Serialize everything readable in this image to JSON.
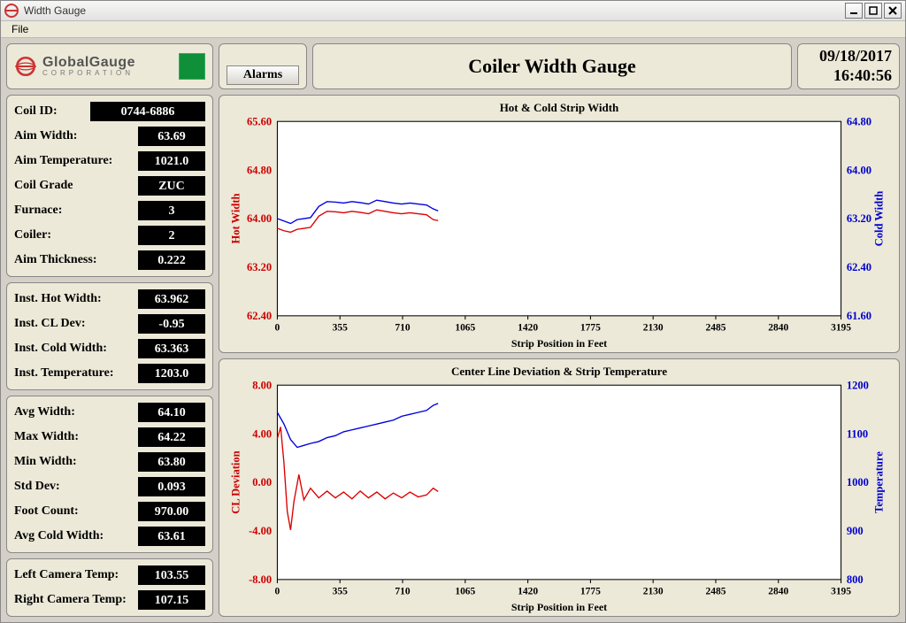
{
  "window": {
    "title": "Width Gauge"
  },
  "menu": {
    "file": "File"
  },
  "brand": {
    "name": "GlobalGauge",
    "sub": "CORPORATION"
  },
  "alarms_label": "Alarms",
  "page_title": "Coiler Width Gauge",
  "datetime": {
    "date": "09/18/2017",
    "time": "16:40:56"
  },
  "group1": {
    "coil_id_label": "Coil ID:",
    "coil_id": "0744-6886",
    "aim_width_label": "Aim Width:",
    "aim_width": "63.69",
    "aim_temp_label": "Aim Temperature:",
    "aim_temp": "1021.0",
    "coil_grade_label": "Coil Grade",
    "coil_grade": "ZUC",
    "furnace_label": "Furnace:",
    "furnace": "3",
    "coiler_label": "Coiler:",
    "coiler": "2",
    "aim_thick_label": "Aim Thickness:",
    "aim_thick": "0.222"
  },
  "group2": {
    "inst_hot_label": "Inst. Hot Width:",
    "inst_hot": "63.962",
    "inst_cl_label": "Inst. CL Dev:",
    "inst_cl": "-0.95",
    "inst_cold_label": "Inst. Cold Width:",
    "inst_cold": "63.363",
    "inst_temp_label": "Inst. Temperature:",
    "inst_temp": "1203.0"
  },
  "group3": {
    "avg_w_label": "Avg Width:",
    "avg_w": "64.10",
    "max_w_label": "Max Width:",
    "max_w": "64.22",
    "min_w_label": "Min Width:",
    "min_w": "63.80",
    "std_label": "Std Dev:",
    "std": "0.093",
    "foot_label": "Foot Count:",
    "foot": "970.00",
    "avg_cold_label": "Avg Cold Width:",
    "avg_cold": "63.61"
  },
  "group4": {
    "left_cam_label": "Left Camera Temp:",
    "left_cam": "103.55",
    "right_cam_label": "Right Camera Temp:",
    "right_cam": "107.15"
  },
  "charts": {
    "x_label": "Strip Position in Feet",
    "x_ticks": [
      "0",
      "355",
      "710",
      "1065",
      "1420",
      "1775",
      "2130",
      "2485",
      "2840",
      "3195"
    ],
    "top": {
      "title": "Hot & Cold Strip Width",
      "left_label": "Hot Width",
      "right_label": "Cold Width",
      "left_ticks": [
        "65.60",
        "64.80",
        "64.00",
        "63.20",
        "62.40"
      ],
      "right_ticks": [
        "64.80",
        "64.00",
        "63.20",
        "62.40",
        "61.60"
      ]
    },
    "bottom": {
      "title": "Center Line Deviation & Strip Temperature",
      "left_label": "CL Deviation",
      "right_label": "Temperature",
      "left_ticks": [
        "8.00",
        "4.00",
        "0.00",
        "-4.00",
        "-8.00"
      ],
      "right_ticks": [
        "1200",
        "1100",
        "1000",
        "900",
        "800"
      ]
    }
  },
  "chart_data": [
    {
      "type": "line",
      "title": "Hot & Cold Strip Width",
      "xlabel": "Strip Position in Feet",
      "xlim": [
        0,
        3400
      ],
      "series": [
        {
          "name": "Hot Width",
          "ylabel": "Hot Width",
          "ylim": [
            62.0,
            66.0
          ],
          "x": [
            0,
            40,
            80,
            120,
            160,
            200,
            250,
            300,
            350,
            400,
            450,
            500,
            550,
            600,
            650,
            700,
            750,
            800,
            850,
            900,
            940,
            970
          ],
          "y": [
            63.8,
            63.75,
            63.72,
            63.78,
            63.8,
            63.82,
            64.05,
            64.15,
            64.14,
            64.12,
            64.15,
            64.13,
            64.1,
            64.18,
            64.15,
            64.12,
            64.1,
            64.12,
            64.1,
            64.08,
            63.98,
            63.96
          ]
        },
        {
          "name": "Cold Width",
          "ylabel": "Cold Width",
          "ylim": [
            61.2,
            65.2
          ],
          "x": [
            0,
            40,
            80,
            120,
            160,
            200,
            250,
            300,
            350,
            400,
            450,
            500,
            550,
            600,
            650,
            700,
            750,
            800,
            850,
            900,
            940,
            970
          ],
          "y": [
            63.2,
            63.15,
            63.1,
            63.18,
            63.2,
            63.22,
            63.45,
            63.55,
            63.54,
            63.52,
            63.55,
            63.53,
            63.5,
            63.58,
            63.55,
            63.52,
            63.5,
            63.52,
            63.5,
            63.48,
            63.4,
            63.36
          ]
        }
      ]
    },
    {
      "type": "line",
      "title": "Center Line Deviation & Strip Temperature",
      "xlabel": "Strip Position in Feet",
      "xlim": [
        0,
        3400
      ],
      "series": [
        {
          "name": "CL Deviation",
          "ylabel": "CL Deviation",
          "ylim": [
            -10,
            10
          ],
          "x": [
            0,
            20,
            40,
            60,
            80,
            100,
            130,
            160,
            200,
            250,
            300,
            350,
            400,
            450,
            500,
            550,
            600,
            650,
            700,
            750,
            800,
            850,
            900,
            940,
            970
          ],
          "y": [
            4.5,
            5.7,
            2.0,
            -3.0,
            -4.9,
            -2.0,
            0.8,
            -1.8,
            -0.6,
            -1.6,
            -0.9,
            -1.6,
            -1.0,
            -1.7,
            -0.9,
            -1.6,
            -1.0,
            -1.7,
            -1.1,
            -1.6,
            -1.0,
            -1.5,
            -1.3,
            -0.6,
            -0.95
          ]
        },
        {
          "name": "Temperature",
          "ylabel": "Temperature",
          "ylim": [
            750,
            1250
          ],
          "x": [
            0,
            40,
            80,
            120,
            160,
            200,
            250,
            300,
            350,
            400,
            450,
            500,
            550,
            600,
            650,
            700,
            750,
            800,
            850,
            900,
            940,
            970
          ],
          "y": [
            1180,
            1150,
            1110,
            1090,
            1095,
            1100,
            1105,
            1115,
            1120,
            1130,
            1135,
            1140,
            1145,
            1150,
            1155,
            1160,
            1170,
            1175,
            1180,
            1185,
            1198,
            1203
          ]
        }
      ]
    }
  ]
}
